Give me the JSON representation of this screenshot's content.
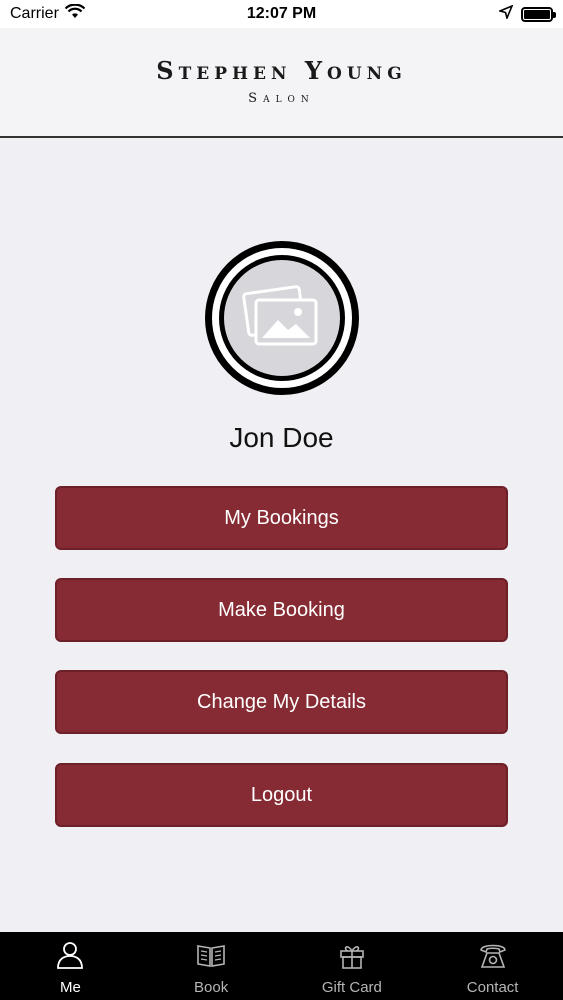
{
  "status_bar": {
    "carrier": "Carrier",
    "time": "12:07 PM"
  },
  "header": {
    "brand_name": "Stephen Young",
    "brand_sub": "Salon"
  },
  "profile": {
    "name": "Jon Doe"
  },
  "actions": [
    {
      "label": "My Bookings"
    },
    {
      "label": "Make Booking"
    },
    {
      "label": "Change My Details"
    },
    {
      "label": "Logout"
    }
  ],
  "tabs": [
    {
      "label": "Me",
      "icon": "person-icon",
      "active": true
    },
    {
      "label": "Book",
      "icon": "book-icon",
      "active": false
    },
    {
      "label": "Gift Card",
      "icon": "gift-icon",
      "active": false
    },
    {
      "label": "Contact",
      "icon": "telephone-icon",
      "active": false
    }
  ],
  "colors": {
    "button_bg": "#862a33",
    "tab_bar_bg": "#000000",
    "page_bg": "#f0eff4"
  }
}
